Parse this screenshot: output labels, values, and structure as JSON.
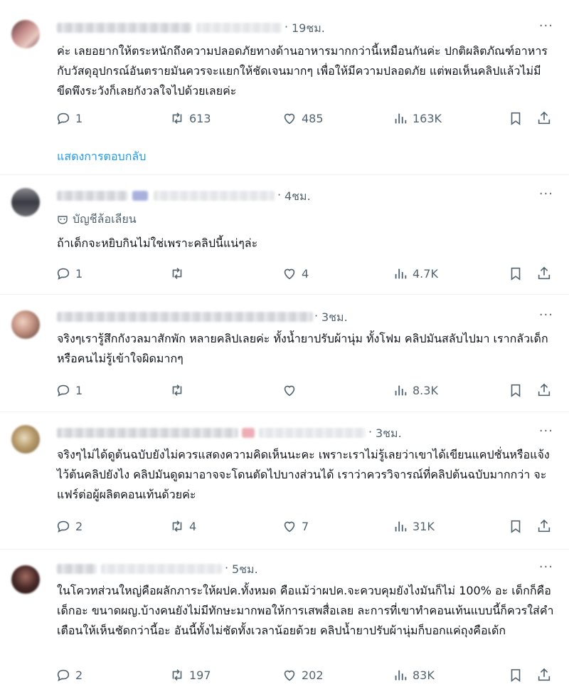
{
  "posts": [
    {
      "time": "19ชม.",
      "more": "···",
      "text": "ค่ะ เลยอยากให้ตระหนักถึงความปลอดภัยทางด้านอาหารมากกว่านี้เหมือนกันค่ะ ปกติผลิตภัณฑ์อาหารกับวัสดุอุปกรณ์อันตรายมันควรจะแยกให้ชัดเจนมากๆ เพื่อให้มีความปลอดภัย แต่พอเห็นคลิปแล้วไม่มีขีดพึงระวังก็เลยกังวลใจไปด้วยเลยค่ะ",
      "replies": "1",
      "reposts": "613",
      "likes": "485",
      "views": "163K",
      "show_replies": "แสดงการตอบกลับ"
    },
    {
      "time": "4ชม.",
      "more": "···",
      "parody_label": "บัญชีล้อเลียน",
      "text": "ถ้าเด็กจะหยิบกินไม่ใช่เพราะคลิปนี้แน่ๆล่ะ",
      "replies": "1",
      "reposts": "",
      "likes": "4",
      "views": "4.7K"
    },
    {
      "time": "3ชม.",
      "more": "···",
      "text": "จริงๆเรารู้สึกกังวลมาสักพัก หลายคลิปเลยค่ะ ทั้งน้ำยาปรับผ้านุ่ม ทั้งโฟม คลิปมันสลับไปมา เรากลัวเด็กหรือคนไม่รู้เข้าใจผิดมากๆ",
      "replies": "1",
      "reposts": "",
      "likes": "",
      "views": "8.3K"
    },
    {
      "time": "3ชม.",
      "more": "···",
      "text": "จริงๆไม่ได้ดูต้นฉบับยังไม่ควรแสดงความคิดเห็นนะคะ เพราะเราไม่รู้เลยว่าเขาได้เขียนแคปชั่นหรือแจ้งไว้ต้นคลิปยังไง คลิปมันดูดมาอาจจะโดนตัดไปบางส่วนได้ เราว่าควรวิจารณ์ที่คลิปต้นฉบับมากกว่า จะแฟร์ต่อผู้ผลิตคอนเท้นด้วยค่ะ",
      "replies": "2",
      "reposts": "4",
      "likes": "7",
      "views": "31K"
    },
    {
      "time": "5ชม.",
      "more": "···",
      "text": "ในโควทส่วนใหญ่คือผลักภาระให้ผปค.ทั้งหมด คือแม้ว่าผปค.จะควบคุมยังไงมันก็ไม่ 100% อะ เด็กก็คือเด็กอะ ขนาดผญ.บ้างคนยังไม่มีทักษะมากพอให้การเสพสื่อเลย ละการที่เขาทำคอนเท้นแบบนี้ก็ควรใส่คำเตือนให้เห็นชัดกว่านี้อะ อันนี้ทั้งไม่ชัดทั้งเวลาน้อยด้วย คลิปน้ำยาปรับผ้านุ่มก็บอกแค่ถุงคือเด้ก",
      "replies": "2",
      "reposts": "197",
      "likes": "202",
      "views": "83K"
    }
  ],
  "icons": {
    "reply": "reply-icon",
    "repost": "repost-icon",
    "like": "like-icon",
    "views": "views-icon",
    "bookmark": "bookmark-icon",
    "share": "share-icon",
    "parody": "parody-mask-icon"
  },
  "colors": {
    "link": "#1d9bf0",
    "muted": "#536471",
    "text": "#0f1419",
    "divider": "#eff3f4"
  }
}
